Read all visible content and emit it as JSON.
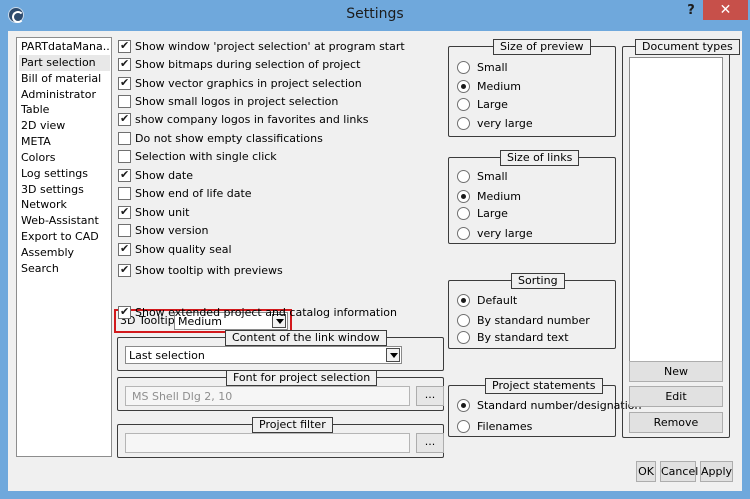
{
  "window": {
    "title": "Settings",
    "help_label": "?",
    "close_label": "✕"
  },
  "nav": {
    "items": [
      "PARTdataMana...",
      "Part selection",
      "Bill of material",
      "Administrator",
      "Table",
      "2D view",
      "META",
      "Colors",
      "Log settings",
      "3D settings",
      "Network",
      "Web-Assistant",
      "Export to CAD",
      "Assembly",
      "Search"
    ],
    "selected_index": 1
  },
  "options": {
    "items": [
      {
        "label": "Show window 'project selection' at program start",
        "checked": true
      },
      {
        "label": "Show bitmaps during selection of project",
        "checked": true
      },
      {
        "label": "Show vector graphics in project selection",
        "checked": true
      },
      {
        "label": "Show small logos in project selection",
        "checked": false
      },
      {
        "label": "show company logos in favorites and links",
        "checked": true
      },
      {
        "label": "Do not show empty classifications",
        "checked": false
      },
      {
        "label": "Selection with single click",
        "checked": false
      },
      {
        "label": "Show date",
        "checked": true
      },
      {
        "label": "Show end of life date",
        "checked": false
      },
      {
        "label": "Show unit",
        "checked": true
      },
      {
        "label": "Show version",
        "checked": false
      },
      {
        "label": "Show quality seal",
        "checked": true
      },
      {
        "label": "Show tooltip with previews",
        "checked": true
      }
    ],
    "tooltip_3d": {
      "label": "3D Tooltip:",
      "value": "Medium"
    },
    "extended_info": {
      "label": "Show extended project and catalog information",
      "checked": true
    }
  },
  "link_window": {
    "title": "Content of the link window",
    "value": "Last selection"
  },
  "font_selection": {
    "title": "Font for project selection",
    "value": "MS Shell Dlg 2, 10",
    "button": "..."
  },
  "project_filter": {
    "title": "Project filter",
    "value": "",
    "button": "..."
  },
  "preview_size": {
    "title": "Size of preview",
    "options": [
      "Small",
      "Medium",
      "Large",
      "very large"
    ],
    "selected": 1
  },
  "links_size": {
    "title": "Size of links",
    "options": [
      "Small",
      "Medium",
      "Large",
      "very large"
    ],
    "selected": 1
  },
  "sorting": {
    "title": "Sorting",
    "options": [
      "Default",
      "By standard number",
      "By standard text"
    ],
    "selected": 0
  },
  "project_statements": {
    "title": "Project statements",
    "options": [
      "Standard number/designation",
      "Filenames"
    ],
    "selected": 0
  },
  "document_types": {
    "title": "Document types",
    "buttons": {
      "new": "New",
      "edit": "Edit",
      "remove": "Remove"
    }
  },
  "footer": {
    "ok": "OK",
    "cancel": "Cancel",
    "apply": "Apply"
  }
}
